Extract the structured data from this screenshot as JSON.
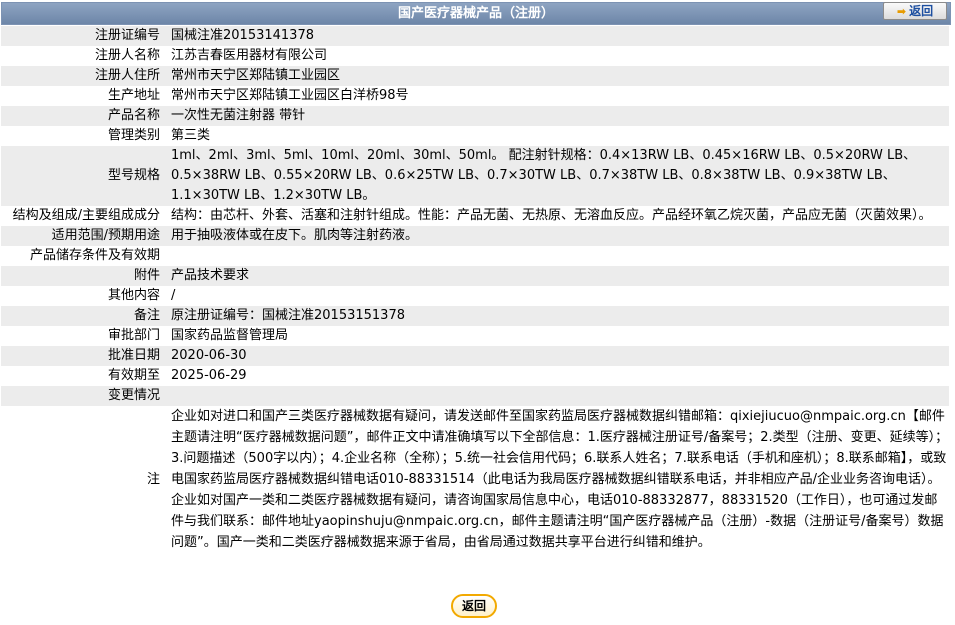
{
  "header": {
    "title": "国产医疗器械产品（注册）",
    "back_label": "返回"
  },
  "rows": [
    {
      "label": "注册证编号",
      "value": "国械注准20153141378"
    },
    {
      "label": "注册人名称",
      "value": "江苏吉春医用器材有限公司"
    },
    {
      "label": "注册人住所",
      "value": "常州市天宁区郑陆镇工业园区"
    },
    {
      "label": "生产地址",
      "value": "常州市天宁区郑陆镇工业园区白洋桥98号"
    },
    {
      "label": "产品名称",
      "value": "一次性无菌注射器 带针"
    },
    {
      "label": "管理类别",
      "value": "第三类"
    },
    {
      "label": "型号规格",
      "value": "1ml、2ml、3ml、5ml、10ml、20ml、30ml、50ml。 配注射针规格：0.4×13RW LB、0.45×16RW LB、0.5×20RW LB、0.5×38RW LB、0.55×20RW LB、0.6×25TW LB、0.7×30TW LB、0.7×38TW LB、0.8×38TW LB、0.9×38TW LB、1.1×30TW LB、1.2×30TW LB。"
    },
    {
      "label": "结构及组成/主要组成成分",
      "value": "结构：由芯杆、外套、活塞和注射针组成。性能：产品无菌、无热原、无溶血反应。产品经环氧乙烷灭菌，产品应无菌（灭菌效果）。"
    },
    {
      "label": "适用范围/预期用途",
      "value": "用于抽吸液体或在皮下。肌肉等注射药液。"
    },
    {
      "label": "产品储存条件及有效期",
      "value": ""
    },
    {
      "label": "附件",
      "value": "产品技术要求"
    },
    {
      "label": "其他内容",
      "value": "/"
    },
    {
      "label": "备注",
      "value": "原注册证编号：国械注准20153151378"
    },
    {
      "label": "审批部门",
      "value": "国家药品监督管理局"
    },
    {
      "label": "批准日期",
      "value": "2020-06-30"
    },
    {
      "label": "有效期至",
      "value": "2025-06-29"
    },
    {
      "label": "变更情况",
      "value": ""
    },
    {
      "label": "注",
      "value": "企业如对进口和国产三类医疗器械数据有疑问，请发送邮件至国家药监局医疗器械数据纠错邮箱：qixiejiucuo@nmpaic.org.cn【邮件主题请注明“医疗器械数据问题”，邮件正文中请准确填写以下全部信息：1.医疗器械注册证号/备案号；2.类型（注册、变更、延续等）；3.问题描述（500字以内）；4.企业名称（全称）；5.统一社会信用代码；6.联系人姓名；7.联系电话（手机和座机）；8.联系邮箱】，或致电国家药监局医疗器械数据纠错电话010-88331514（此电话为我局医疗器械数据纠错联系电话，并非相应产品/企业业务咨询电话）。企业如对国产一类和二类医疗器械数据有疑问，请咨询国家局信息中心，电话010-88332877，88331520（工作日），也可通过发邮件与我们联系：邮件地址yaopinshuju@nmpaic.org.cn，邮件主题请注明“国产医疗器械产品（注册）-数据（注册证号/备案号）数据问题”。国产一类和二类医疗器械数据来源于省局，由省局通过数据共享平台进行纠错和维护。"
    }
  ],
  "footer": {
    "back_label": "返回"
  }
}
